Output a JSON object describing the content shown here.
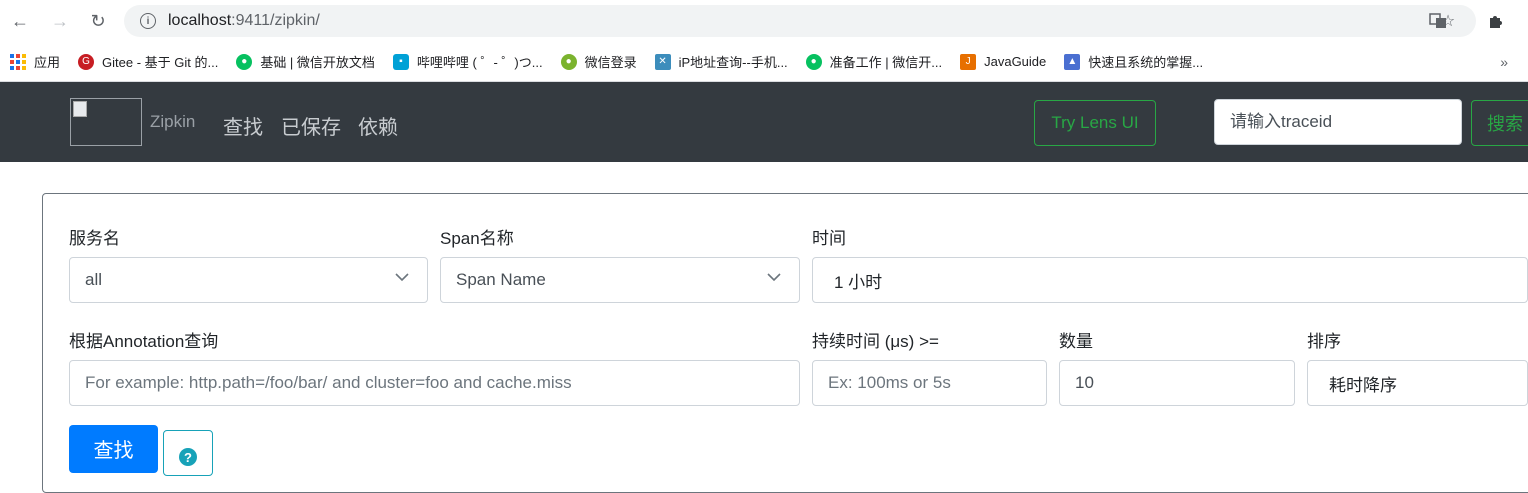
{
  "browser": {
    "url_host": "localhost",
    "url_rest": ":9411/zipkin/",
    "bookmarks": [
      {
        "label": "应用",
        "icon": "apps-grid-icon"
      },
      {
        "label": "Gitee - 基于 Git 的...",
        "icon": "gitee-icon",
        "color": "#c71d23"
      },
      {
        "label": "基础 | 微信开放文档",
        "icon": "wechat-icon",
        "color": "#07c160"
      },
      {
        "label": "哔哩哔哩 ( ゜- ゜)つ...",
        "icon": "bilibili-icon",
        "color": "#00a1d6"
      },
      {
        "label": "微信登录",
        "icon": "wechat-bubble-icon",
        "color": "#7bb32e"
      },
      {
        "label": "iP地址查询--手机...",
        "icon": "ip-lookup-icon",
        "color": "#3c8dbc"
      },
      {
        "label": "准备工作 | 微信开...",
        "icon": "wechat-icon",
        "color": "#07c160"
      },
      {
        "label": "JavaGuide",
        "icon": "javaguide-icon",
        "color": "#e76f00"
      },
      {
        "label": "快速且系统的掌握...",
        "icon": "book-icon",
        "color": "#4a6fd1"
      }
    ],
    "more_label": "»"
  },
  "navbar": {
    "brand": "Zipkin",
    "links": [
      "查找",
      "已保存",
      "依赖"
    ],
    "lens_label": "Try Lens UI",
    "trace_placeholder": "请输入traceid",
    "search_label": "搜索",
    "accent": "#28a745",
    "bg": "#343a40"
  },
  "form": {
    "service_label": "服务名",
    "service_value": "all",
    "span_label": "Span名称",
    "span_value": "Span Name",
    "time_label": "时间",
    "time_value": "1 小时",
    "annotation_label": "根据Annotation查询",
    "annotation_placeholder": "For example: http.path=/foo/bar/ and cluster=foo and cache.miss",
    "duration_label": "持续时间 (μs) >=",
    "duration_placeholder": "Ex: 100ms or 5s",
    "limit_label": "数量",
    "limit_value": "10",
    "sort_label": "排序",
    "sort_value": "耗时降序",
    "find_label": "查找",
    "help_symbol": "?",
    "primary": "#007bff",
    "info": "#17a2b8"
  }
}
